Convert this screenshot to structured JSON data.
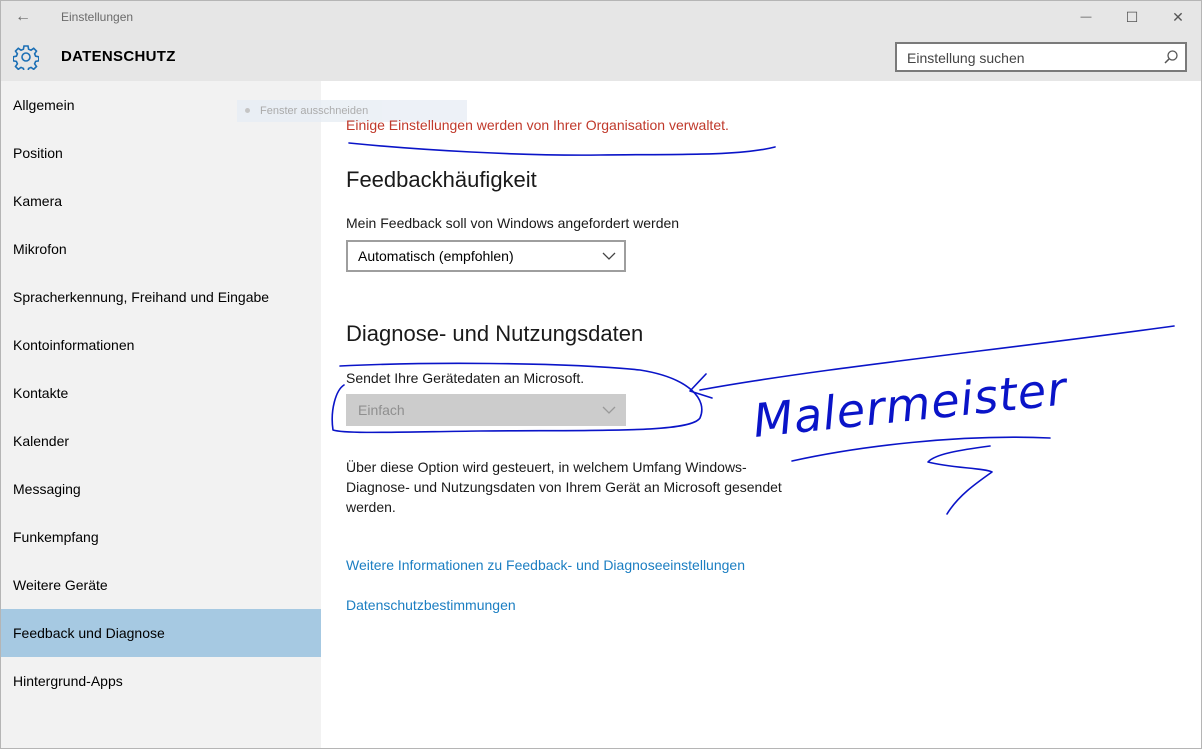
{
  "window": {
    "title": "Einstellungen",
    "back_icon": "←",
    "minimize_icon": "—",
    "maximize_icon": "☐",
    "close_icon": "✕"
  },
  "header": {
    "title": "DATENSCHUTZ",
    "icon": "gear-icon",
    "search_placeholder": "Einstellung suchen"
  },
  "sidebar": {
    "items": [
      {
        "label": "Allgemein"
      },
      {
        "label": "Position"
      },
      {
        "label": "Kamera"
      },
      {
        "label": "Mikrofon"
      },
      {
        "label": "Spracherkennung, Freihand und Eingabe"
      },
      {
        "label": "Kontoinformationen"
      },
      {
        "label": "Kontakte"
      },
      {
        "label": "Kalender"
      },
      {
        "label": "Messaging"
      },
      {
        "label": "Funkempfang"
      },
      {
        "label": "Weitere Geräte"
      },
      {
        "label": "Feedback und Diagnose",
        "selected": true
      },
      {
        "label": "Hintergrund-Apps"
      }
    ],
    "ghost_tooltip": "Fenster ausschneiden"
  },
  "main": {
    "org_note": "Einige Einstellungen werden von Ihrer Organisation verwaltet.",
    "feedback": {
      "heading": "Feedbackhäufigkeit",
      "label": "Mein Feedback soll von Windows angefordert werden",
      "selected": "Automatisch (empfohlen)"
    },
    "diagnostics": {
      "heading": "Diagnose- und Nutzungsdaten",
      "label": "Sendet Ihre Gerätedaten an Microsoft.",
      "selected": "Einfach",
      "description": "Über diese Option wird gesteuert, in welchem Umfang Windows-Diagnose- und Nutzungsdaten von Ihrem Gerät an Microsoft gesendet werden."
    },
    "links": {
      "more_info": "Weitere Informationen zu Feedback- und Diagnoseeinstellungen",
      "privacy": "Datenschutzbestimmungen"
    }
  },
  "annotation": {
    "handwritten_text": "Malermeister",
    "ink_color": "#0a14c8"
  },
  "colors": {
    "accent_link": "#1b7ec2",
    "warning_text": "#c0392b",
    "selected_nav": "#a6c9e2",
    "sidebar_bg": "#f2f2f2",
    "header_bg": "#e6e6e6"
  }
}
